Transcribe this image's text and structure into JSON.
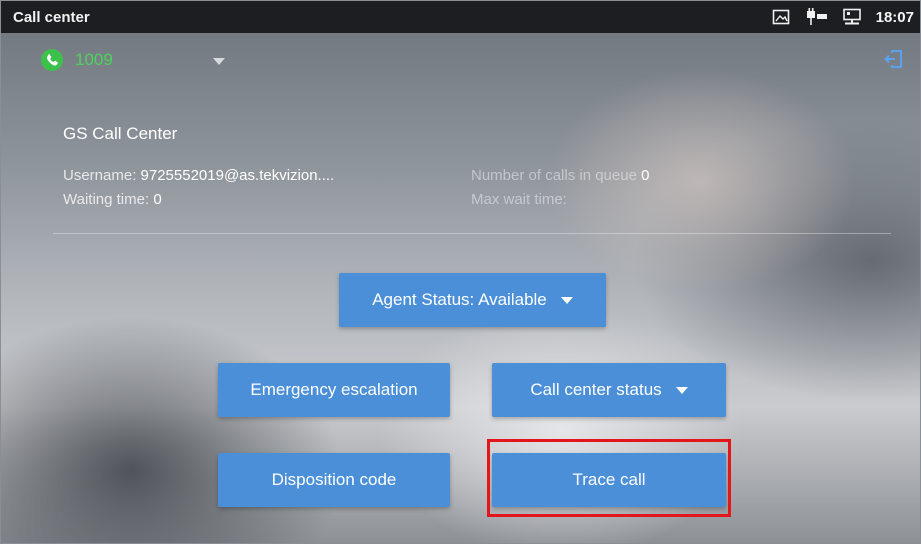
{
  "statusbar": {
    "title": "Call center",
    "time": "18:07",
    "icons": [
      "screenshot-icon",
      "poe-icon",
      "network-icon"
    ]
  },
  "account": {
    "number": "1009",
    "icon": "phone-icon",
    "status_color": "#3cc24a"
  },
  "panel": {
    "title": "GS Call Center",
    "username_label": "Username:",
    "username_value": "9725552019@as.tekvizion....",
    "waiting_label": "Waiting time:",
    "waiting_value": "0",
    "queue_label": "Number of calls in queue",
    "queue_value": "0",
    "maxwait_label": "Max wait time:"
  },
  "buttons": {
    "agent_status": "Agent Status: Available",
    "emergency": "Emergency escalation",
    "call_center_status": "Call center status",
    "disposition": "Disposition code",
    "trace_call": "Trace call"
  },
  "colors": {
    "button_blue": "#4a8fd8",
    "highlight_red": "#e3161b",
    "accent_green": "#4ed35a"
  }
}
